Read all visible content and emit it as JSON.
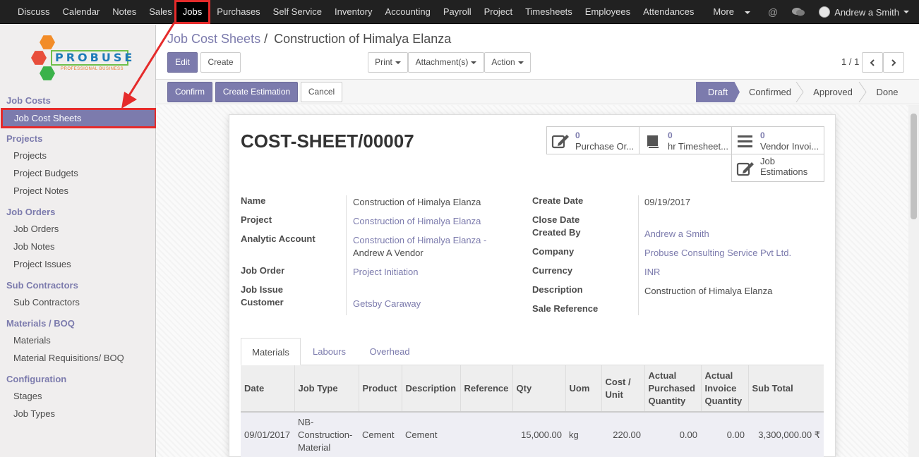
{
  "topbar": {
    "menu": [
      "Discuss",
      "Calendar",
      "Notes",
      "Sales",
      "Jobs",
      "Purchases",
      "Self Service",
      "Inventory",
      "Accounting",
      "Payroll",
      "Project",
      "Timesheets",
      "Employees",
      "Attendances",
      "More"
    ],
    "active": "Jobs",
    "user": "Andrew a Smith"
  },
  "sidebar": {
    "logo_word": "PROBUSE",
    "logo_tag": "PROFESSIONAL BUSINESS",
    "sections": [
      {
        "title": "Job Costs",
        "items": [
          "Job Cost Sheets"
        ]
      },
      {
        "title": "Projects",
        "items": [
          "Projects",
          "Project Budgets",
          "Project Notes"
        ]
      },
      {
        "title": "Job Orders",
        "items": [
          "Job Orders",
          "Job Notes",
          "Project Issues"
        ]
      },
      {
        "title": "Sub Contractors",
        "items": [
          "Sub Contractors"
        ]
      },
      {
        "title": "Materials / BOQ",
        "items": [
          "Materials",
          "Material Requisitions/ BOQ"
        ]
      },
      {
        "title": "Configuration",
        "items": [
          "Stages",
          "Job Types"
        ]
      }
    ]
  },
  "breadcrumb": {
    "parent": "Job Cost Sheets",
    "separator": "/",
    "current": "Construction of Himalya Elanza"
  },
  "buttons": {
    "edit": "Edit",
    "create": "Create",
    "print": "Print",
    "attachments": "Attachment(s)",
    "action": "Action",
    "confirm": "Confirm",
    "create_estimation": "Create Estimation",
    "cancel": "Cancel"
  },
  "pager": "1 / 1",
  "stages": [
    "Draft",
    "Confirmed",
    "Approved",
    "Done"
  ],
  "current_stage": "Draft",
  "record": {
    "title": "COST-SHEET/00007",
    "smart_buttons": [
      {
        "count": "0",
        "label": "Purchase Or...",
        "icon": "pencil-square-icon"
      },
      {
        "count": "0",
        "label": "hr Timesheet...",
        "icon": "book-icon"
      },
      {
        "count": "0",
        "label": "Vendor Invoi...",
        "icon": "bars-icon"
      },
      {
        "count": "",
        "label": "Job Estimations",
        "icon": "pencil-square-icon"
      }
    ],
    "smart_label_job": "Job",
    "smart_label_est": "Estimations",
    "labels": {
      "name": "Name",
      "project": "Project",
      "analytic": "Analytic Account",
      "job_order": "Job Order",
      "job_issue": "Job Issue",
      "customer": "Customer",
      "create_date": "Create Date",
      "close_date": "Close Date",
      "created_by": "Created By",
      "company": "Company",
      "currency": "Currency",
      "description": "Description",
      "sale_reference": "Sale Reference"
    },
    "values": {
      "name": "Construction of Himalya Elanza",
      "project": "Construction of Himalya Elanza",
      "analytic_1": "Construction of Himalya Elanza -",
      "analytic_2": "Andrew A Vendor",
      "job_order": "Project Initiation",
      "customer": "Getsby Caraway",
      "create_date": "09/19/2017",
      "created_by": "Andrew a Smith",
      "company": "Probuse Consulting Service Pvt Ltd.",
      "currency": "INR",
      "description": "Construction of Himalya Elanza"
    }
  },
  "tabs": [
    "Materials",
    "Labours",
    "Overhead"
  ],
  "table": {
    "headers": [
      "Date",
      "Job Type",
      "Product",
      "Description",
      "Reference",
      "Qty",
      "Uom",
      "Cost / Unit",
      "Actual Purchased Quantity",
      "Actual Invoice Quantity",
      "Sub Total"
    ],
    "rows": [
      [
        "09/01/2017",
        "NB-Construction-Material",
        "Cement",
        "Cement",
        "",
        "15,000.00",
        "kg",
        "220.00",
        "0.00",
        "0.00",
        "3,300,000.00 ₹"
      ]
    ]
  }
}
